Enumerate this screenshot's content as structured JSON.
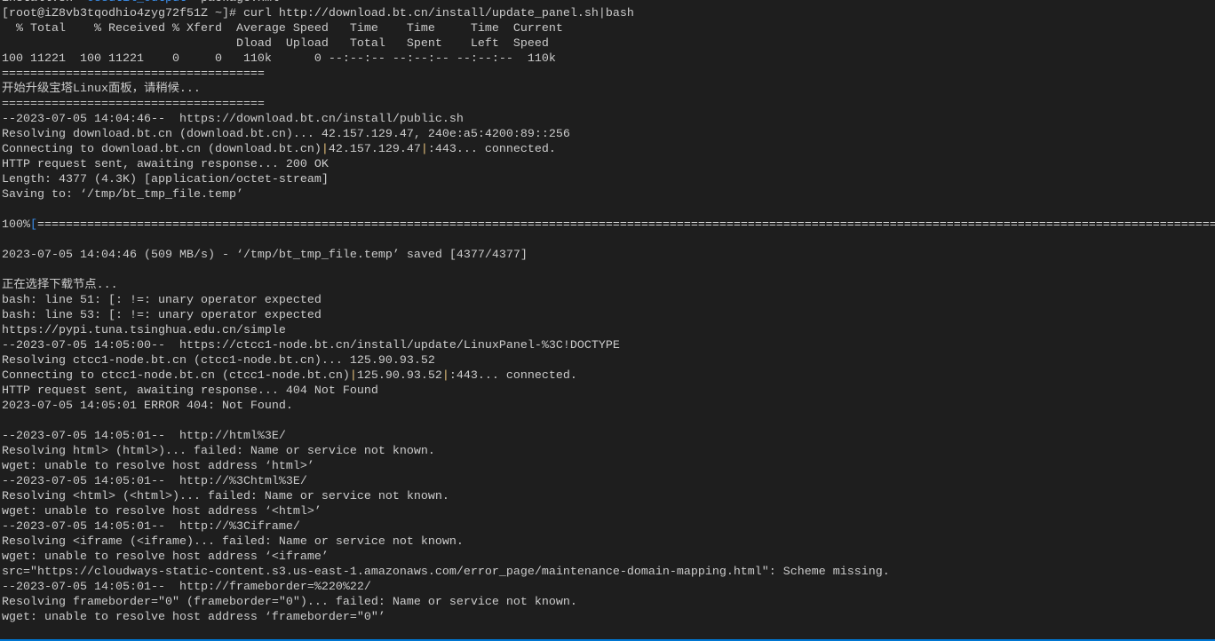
{
  "colors": {
    "background": "#1e1e1e",
    "text": "#cccccc",
    "directory": "#3b8eea",
    "accent": "#0078d4"
  },
  "terminal": {
    "lines": [
      [
        {
          "t": "install.sh  "
        },
        {
          "t": "ossutil_output",
          "c": "blue"
        },
        {
          "t": "  package.xml"
        }
      ],
      [
        {
          "t": "[root@iZ8vb3tqodhio4zyg72f51Z ~]# curl http://download.bt.cn/install/update_panel.sh|bash"
        }
      ],
      [
        {
          "t": "  % Total    % Received % Xferd  Average Speed   Time    Time     Time  Current"
        }
      ],
      [
        {
          "t": "                                 Dload  Upload   Total   Spent    Left  Speed"
        }
      ],
      [
        {
          "t": "100 11221  100 11221    0     0   110k      0 --:--:-- --:--:-- --:--:--  110k"
        }
      ],
      [
        {
          "t": "====================================="
        }
      ],
      [
        {
          "t": "开始升级宝塔Linux面板，请稍候..."
        }
      ],
      [
        {
          "t": "====================================="
        }
      ],
      [
        {
          "t": "--2023-07-05 14:04:46--  https://download.bt.cn/install/public.sh"
        }
      ],
      [
        {
          "t": "Resolving download.bt.cn (download.bt.cn)... 42.157.129.47, 240e:a5:4200:89::256"
        }
      ],
      [
        {
          "t": "Connecting to download.bt.cn (download.bt.cn)"
        },
        {
          "t": "|",
          "c": "pipe"
        },
        {
          "t": "42.157.129.47"
        },
        {
          "t": "|",
          "c": "pipe"
        },
        {
          "t": ":443... connected."
        }
      ],
      [
        {
          "t": "HTTP request sent, awaiting response... 200 OK"
        }
      ],
      [
        {
          "t": "Length: 4377 (4.3K) [application/octet-stream]"
        }
      ],
      [
        {
          "t": "Saving to: ‘/tmp/bt_tmp_file.temp’"
        }
      ],
      [
        {
          "t": ""
        }
      ],
      [
        {
          "t": "100%"
        },
        {
          "t": "[",
          "c": "bracket"
        },
        {
          "t": "==========================================================================================================================================================================",
          "c": "bar"
        }
      ],
      [
        {
          "t": ""
        }
      ],
      [
        {
          "t": "2023-07-05 14:04:46 (509 MB/s) - ‘/tmp/bt_tmp_file.temp’ saved [4377/4377]"
        }
      ],
      [
        {
          "t": ""
        }
      ],
      [
        {
          "t": "正在选择下载节点..."
        }
      ],
      [
        {
          "t": "bash: line 51: [: !=: unary operator expected"
        }
      ],
      [
        {
          "t": "bash: line 53: [: !=: unary operator expected"
        }
      ],
      [
        {
          "t": "https://pypi.tuna.tsinghua.edu.cn/simple"
        }
      ],
      [
        {
          "t": "--2023-07-05 14:05:00--  https://ctcc1-node.bt.cn/install/update/LinuxPanel-%3C!DOCTYPE"
        }
      ],
      [
        {
          "t": "Resolving ctcc1-node.bt.cn (ctcc1-node.bt.cn)... 125.90.93.52"
        }
      ],
      [
        {
          "t": "Connecting to ctcc1-node.bt.cn (ctcc1-node.bt.cn)"
        },
        {
          "t": "|",
          "c": "pipe"
        },
        {
          "t": "125.90.93.52"
        },
        {
          "t": "|",
          "c": "pipe"
        },
        {
          "t": ":443... connected."
        }
      ],
      [
        {
          "t": "HTTP request sent, awaiting response... 404 Not Found"
        }
      ],
      [
        {
          "t": "2023-07-05 14:05:01 ERROR 404: Not Found."
        }
      ],
      [
        {
          "t": ""
        }
      ],
      [
        {
          "t": "--2023-07-05 14:05:01--  http://html%3E/"
        }
      ],
      [
        {
          "t": "Resolving html> (html>)... failed: Name or service not known."
        }
      ],
      [
        {
          "t": "wget: unable to resolve host address ‘html>’"
        }
      ],
      [
        {
          "t": "--2023-07-05 14:05:01--  http://%3Chtml%3E/"
        }
      ],
      [
        {
          "t": "Resolving <html> (<html>)... failed: Name or service not known."
        }
      ],
      [
        {
          "t": "wget: unable to resolve host address ‘<html>’"
        }
      ],
      [
        {
          "t": "--2023-07-05 14:05:01--  http://%3Ciframe/"
        }
      ],
      [
        {
          "t": "Resolving <iframe (<iframe)... failed: Name or service not known."
        }
      ],
      [
        {
          "t": "wget: unable to resolve host address ‘<iframe’"
        }
      ],
      [
        {
          "t": "src=\"https://cloudways-static-content.s3.us-east-1.amazonaws.com/error_page/maintenance-domain-mapping.html\": Scheme missing."
        }
      ],
      [
        {
          "t": "--2023-07-05 14:05:01--  http://frameborder=%220%22/"
        }
      ],
      [
        {
          "t": "Resolving frameborder=\"0\" (frameborder=\"0\")... failed: Name or service not known."
        }
      ],
      [
        {
          "t": "wget: unable to resolve host address ‘frameborder=\"0\"’"
        }
      ]
    ]
  }
}
